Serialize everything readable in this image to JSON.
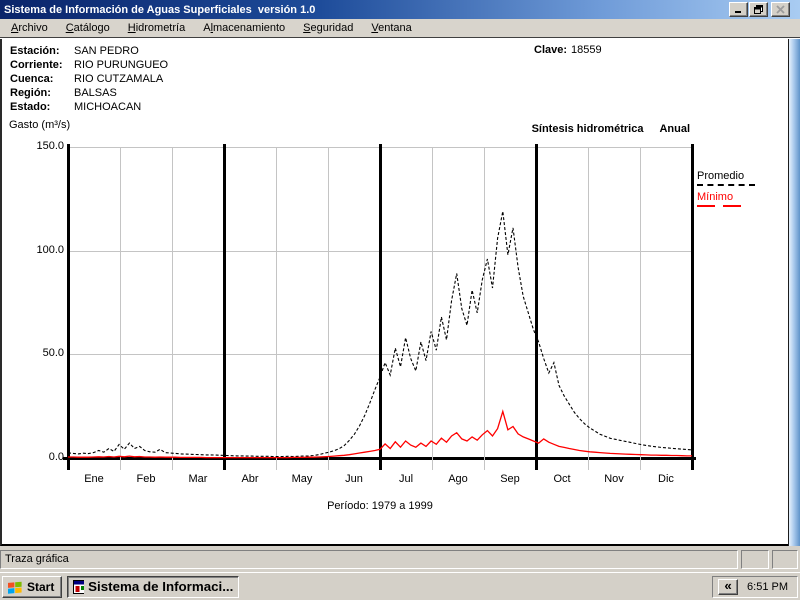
{
  "window": {
    "title": "Sistema de Información de Aguas Superficiales  versión 1.0"
  },
  "menu": {
    "items": [
      {
        "label": "Archivo",
        "accel_index": 0
      },
      {
        "label": "Catálogo",
        "accel_index": 0
      },
      {
        "label": "Hidrometría",
        "accel_index": 0
      },
      {
        "label": "Almacenamiento",
        "accel_index": 1
      },
      {
        "label": "Seguridad",
        "accel_index": 0
      },
      {
        "label": "Ventana",
        "accel_index": 0
      }
    ]
  },
  "station": {
    "rows": [
      {
        "label": "Estación:",
        "value": "SAN PEDRO"
      },
      {
        "label": "Corriente:",
        "value": "RIO PURUNGUEO"
      },
      {
        "label": "Cuenca:",
        "value": "RIO CUTZAMALA"
      },
      {
        "label": "Región:",
        "value": "BALSAS"
      },
      {
        "label": "Estado:",
        "value": "MICHOACAN"
      }
    ],
    "clave_label": "Clave:",
    "clave_value": "18559"
  },
  "chart": {
    "gasto_label": "Gasto (m³/s)",
    "title": "Síntesis hidrométrica",
    "subtitle": "Anual",
    "period": "Período:  1979 a 1999"
  },
  "chart_data": {
    "type": "line",
    "title": "Síntesis hidrométrica Anual",
    "ylabel": "Gasto (m3/s)",
    "xlabel": "Período: 1979 a 1999",
    "categories": [
      "Ene",
      "Feb",
      "Mar",
      "Abr",
      "May",
      "Jun",
      "Jul",
      "Ago",
      "Sep",
      "Oct",
      "Nov",
      "Dic"
    ],
    "ylim": [
      0,
      150
    ],
    "yticks": [
      0,
      50,
      100,
      150
    ],
    "grid": true,
    "legend_position": "right",
    "series": [
      {
        "name": "Promedio",
        "color": "#000000",
        "style": "dashed",
        "values": [
          2.5,
          2.2,
          2.0,
          2.3,
          2.1,
          2.6,
          3.6,
          2.8,
          4.6,
          3.2,
          6.5,
          4.2,
          7.2,
          4.6,
          5.6,
          3.6,
          3.0,
          2.8,
          4.2,
          2.6,
          2.4,
          2.2,
          2.0,
          1.9,
          1.8,
          1.7,
          1.6,
          1.5,
          1.5,
          1.4,
          1.3,
          1.2,
          1.1,
          1.0,
          1.0,
          0.9,
          0.9,
          0.8,
          0.8,
          0.8,
          0.7,
          0.7,
          0.7,
          0.8,
          0.7,
          0.8,
          0.9,
          1.0,
          1.2,
          1.6,
          2.2,
          2.8,
          3.5,
          4.5,
          6.0,
          8.5,
          11.5,
          15.5,
          20.5,
          26.5,
          33.0,
          39.0,
          46.0,
          40.0,
          53.0,
          44.0,
          58.0,
          48.0,
          42.0,
          56.0,
          47.0,
          61.0,
          52.0,
          68.0,
          57.0,
          76.0,
          89.0,
          72.0,
          64.0,
          81.0,
          70.0,
          86.0,
          96.0,
          82.0,
          106.0,
          119.0,
          98.0,
          111.0,
          92.0,
          78.0,
          70.0,
          62.0,
          56.0,
          48.0,
          41.0,
          46.0,
          35.0,
          30.0,
          26.0,
          22.0,
          19.0,
          16.5,
          14.5,
          13.0,
          11.5,
          10.5,
          9.5,
          9.0,
          8.5,
          8.0,
          7.5,
          7.0,
          6.5,
          6.1,
          5.7,
          5.4,
          5.1,
          4.9,
          4.7,
          4.5,
          4.3,
          4.1,
          3.9
        ]
      },
      {
        "name": "Mínimo",
        "color": "#ff0000",
        "style": "solid",
        "values": [
          0.5,
          0.5,
          0.4,
          0.4,
          0.4,
          0.5,
          0.6,
          0.5,
          0.7,
          0.5,
          0.8,
          0.6,
          0.9,
          0.6,
          0.7,
          0.5,
          0.5,
          0.4,
          0.5,
          0.4,
          0.4,
          0.4,
          0.3,
          0.3,
          0.3,
          0.3,
          0.3,
          0.2,
          0.2,
          0.2,
          0.2,
          0.2,
          0.2,
          0.2,
          0.2,
          0.2,
          0.2,
          0.2,
          0.2,
          0.2,
          0.2,
          0.2,
          0.2,
          0.2,
          0.3,
          0.3,
          0.3,
          0.4,
          0.4,
          0.5,
          0.6,
          0.7,
          0.9,
          1.1,
          1.3,
          1.6,
          2.0,
          2.4,
          2.8,
          3.2,
          3.6,
          4.2,
          6.8,
          4.6,
          7.8,
          5.2,
          8.2,
          6.2,
          5.2,
          7.2,
          5.6,
          8.2,
          6.6,
          9.6,
          7.6,
          10.6,
          12.2,
          9.2,
          8.2,
          10.2,
          8.6,
          11.2,
          13.2,
          10.6,
          14.2,
          22.5,
          13.6,
          15.2,
          11.6,
          10.2,
          9.2,
          8.2,
          7.2,
          9.2,
          7.6,
          6.6,
          5.6,
          5.1,
          4.6,
          4.1,
          3.6,
          3.3,
          3.0,
          2.8,
          2.6,
          2.4,
          2.2,
          2.1,
          2.0,
          1.9,
          1.8,
          1.7,
          1.6,
          1.5,
          1.4,
          1.4,
          1.3,
          1.3,
          1.2,
          1.2,
          1.1,
          1.0,
          1.0
        ]
      }
    ]
  },
  "statusbar": {
    "text": "Traza gráfica"
  },
  "taskbar": {
    "start_label": "Start",
    "task_label": "Sistema de Informaci...",
    "tray_chevron": "«",
    "clock": "6:51 PM"
  },
  "icons": {
    "titlebar": [
      "minimize-icon",
      "restore-icon",
      "close-icon"
    ],
    "start_button": "windows-flag-icon",
    "task_button": "app-icon",
    "tray": "collapse-chevron-icon"
  },
  "colors": {
    "titlebar_start": "#0a246a",
    "titlebar_end": "#a9ccf2",
    "chrome_gray": "#d4d0c8",
    "promedio": "#000000",
    "minimo": "#ff0000",
    "gridline": "#c4c4c4"
  }
}
